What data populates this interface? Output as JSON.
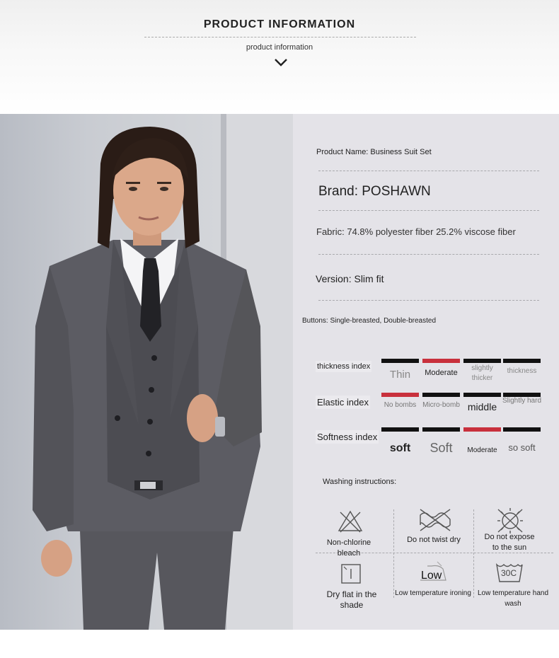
{
  "header": {
    "title": "PRODUCT INFORMATION",
    "subtitle": "product information",
    "chevron_icon": "chevron-down-icon"
  },
  "product": {
    "name": "Product Name: Business Suit Set",
    "brand": "Brand: POSHAWN",
    "fabric": "Fabric: 74.8% polyester fiber 25.2% viscose fiber",
    "version": "Version: Slim fit",
    "buttons": "Buttons: Single-breasted, Double-breasted"
  },
  "indexes": {
    "thickness": {
      "label": "thickness index",
      "options": [
        "Thin",
        "Moderate",
        "slightly thicker",
        "thickness"
      ],
      "selected": 1
    },
    "elastic": {
      "label": "Elastic index",
      "options": [
        "No bombs",
        "Micro-bomb",
        "middle",
        "Slightly hard"
      ],
      "selected": 0
    },
    "softness": {
      "label": "Softness index",
      "options": [
        "soft",
        "Soft",
        "Moderate",
        "so soft"
      ],
      "selected": 2
    }
  },
  "washing": {
    "title": "Washing instructions:",
    "items": [
      {
        "label": "Non-chlorine bleach",
        "icon": "non-chlorine-bleach-icon"
      },
      {
        "label": "Do not twist dry",
        "icon": "do-not-wring-icon"
      },
      {
        "label": "Do not expose to the sun",
        "icon": "no-sun-icon"
      },
      {
        "label": "Dry flat in the shade",
        "icon": "dry-flat-shade-icon"
      },
      {
        "label": "Low temperature ironing",
        "icon": "low-iron-icon",
        "icon_text": "Low"
      },
      {
        "label": "Low temperature hand wash",
        "icon": "hand-wash-30-icon",
        "icon_text": "30C"
      }
    ]
  },
  "colors": {
    "accent_red": "#c8303c",
    "bar_black": "#111111",
    "panel_bg": "#e4e3e8"
  }
}
